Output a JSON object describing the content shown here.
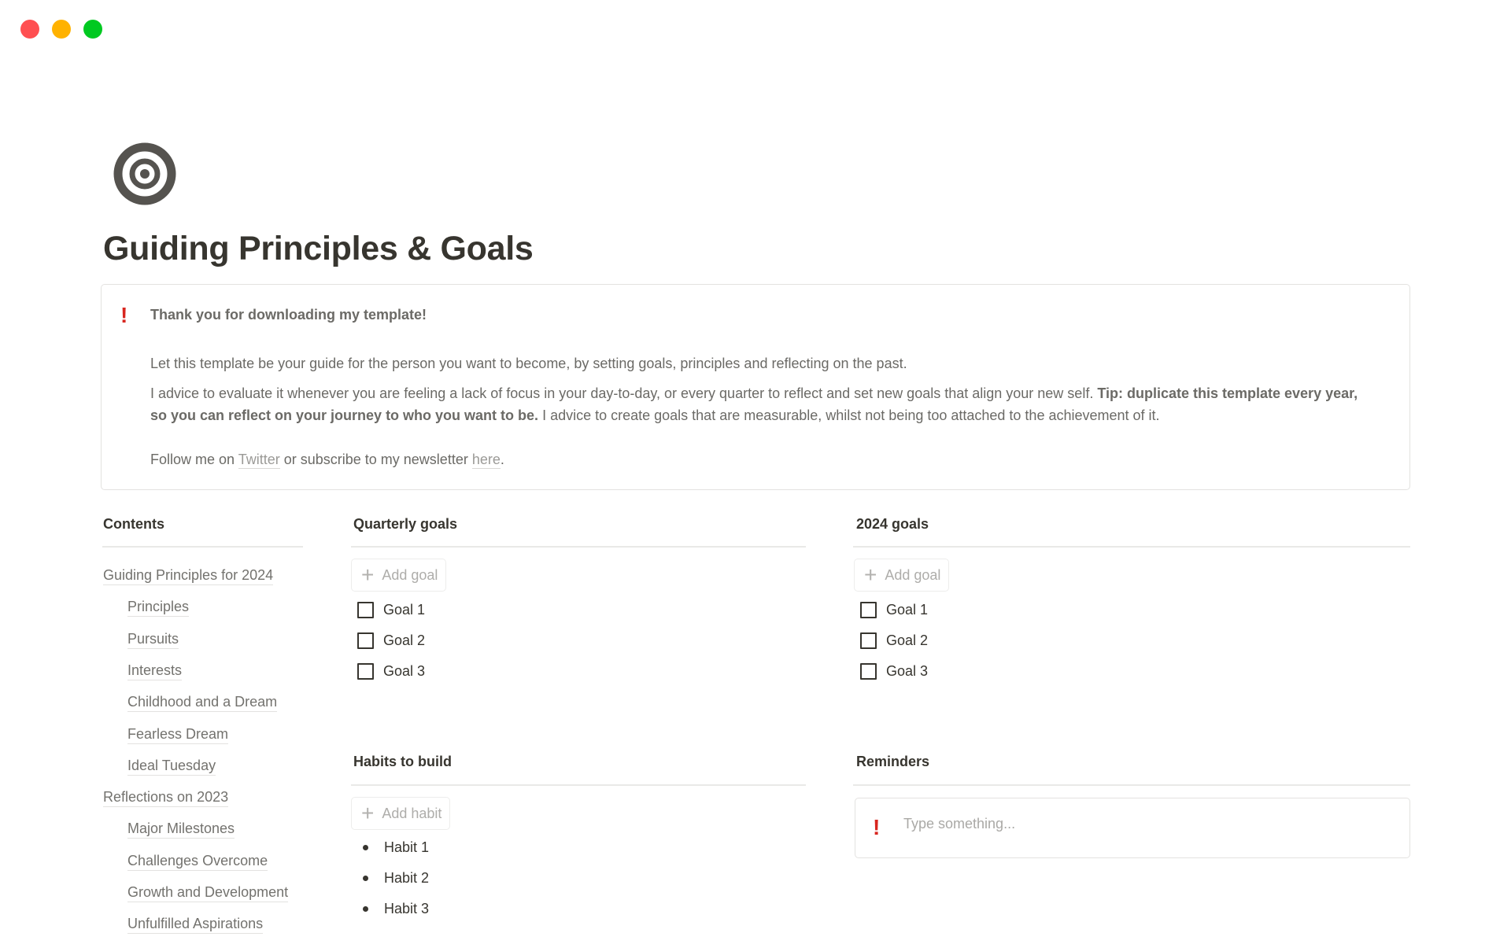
{
  "window": {
    "controls": [
      "close",
      "minimize",
      "maximize"
    ]
  },
  "page": {
    "icon": "target-icon",
    "title": "Guiding Principles & Goals"
  },
  "callout": {
    "icon": "exclamation-icon",
    "icon_glyph": "!",
    "heading": "Thank you for downloading my template!",
    "paragraph1": "Let this template be your guide for the person you want to become, by setting goals, principles and reflecting on the past.",
    "paragraph2_start": "I advice to evaluate it whenever you are feeling a lack of focus in your day-to-day, or every quarter to reflect and set new goals that align your new self. ",
    "paragraph2_bold": "Tip: duplicate this template every year, so you can reflect on your journey to who you want to be.",
    "paragraph2_end": " I advice to create goals that are measurable, whilst not being too attached to the achievement of it.",
    "follow_prefix": "Follow me on ",
    "twitter_link": "Twitter",
    "follow_middle": " or subscribe to my newsletter ",
    "newsletter_link": "here",
    "follow_suffix": "."
  },
  "contents": {
    "heading": "Contents",
    "items": [
      {
        "label": "Guiding Principles for 2024",
        "level": 0
      },
      {
        "label": "Principles",
        "level": 1
      },
      {
        "label": "Pursuits",
        "level": 1
      },
      {
        "label": "Interests",
        "level": 1
      },
      {
        "label": "Childhood and a Dream",
        "level": 1
      },
      {
        "label": "Fearless Dream",
        "level": 1
      },
      {
        "label": "Ideal Tuesday",
        "level": 1
      },
      {
        "label": "Reflections on 2023",
        "level": 0
      },
      {
        "label": "Major Milestones",
        "level": 1
      },
      {
        "label": "Challenges Overcome",
        "level": 1
      },
      {
        "label": "Growth and Development",
        "level": 1
      },
      {
        "label": "Unfulfilled Aspirations",
        "level": 1
      }
    ]
  },
  "quarterly_goals": {
    "heading": "Quarterly goals",
    "add_label": "Add goal",
    "items": [
      {
        "label": "Goal 1",
        "checked": false
      },
      {
        "label": "Goal 2",
        "checked": false
      },
      {
        "label": "Goal 3",
        "checked": false
      }
    ]
  },
  "yearly_goals": {
    "heading": "2024 goals",
    "add_label": "Add goal",
    "items": [
      {
        "label": "Goal 1",
        "checked": false
      },
      {
        "label": "Goal 2",
        "checked": false
      },
      {
        "label": "Goal 3",
        "checked": false
      }
    ]
  },
  "habits": {
    "heading": "Habits to build",
    "add_label": "Add habit",
    "items": [
      "Habit 1",
      "Habit 2",
      "Habit 3"
    ]
  },
  "reminders": {
    "heading": "Reminders",
    "icon_glyph": "!",
    "placeholder": "Type something..."
  },
  "colors": {
    "accent_red": "#d8261f",
    "text": "#37352f",
    "muted_text": "#6b6a66"
  }
}
